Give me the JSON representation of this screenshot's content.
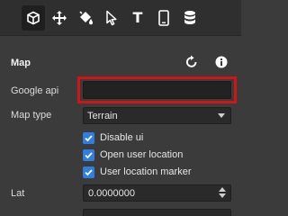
{
  "toolbar": {
    "tools": [
      {
        "icon": "cube-icon",
        "active": true
      },
      {
        "icon": "move-arrows-icon",
        "active": false
      },
      {
        "icon": "paint-bucket-icon",
        "active": false
      },
      {
        "icon": "cursor-pointer-icon",
        "active": false
      },
      {
        "icon": "text-tool-icon",
        "active": false,
        "glyph": "T"
      },
      {
        "icon": "phone-device-icon",
        "active": false
      },
      {
        "icon": "database-icon",
        "active": false
      }
    ]
  },
  "section": {
    "title": "Map",
    "reset_icon": "refresh-icon",
    "info_icon": "info-icon"
  },
  "fields": {
    "google_api": {
      "label": "Google api",
      "value": "",
      "placeholder": ""
    },
    "map_type": {
      "label": "Map type",
      "value": "Terrain"
    },
    "checkboxes": [
      {
        "label": "Disable ui",
        "checked": true
      },
      {
        "label": "Open user location",
        "checked": true
      },
      {
        "label": "User location marker",
        "checked": true
      }
    ],
    "lat": {
      "label": "Lat",
      "value": "0.0000000"
    }
  },
  "colors": {
    "background": "#3b3b3b",
    "toolbar": "#2f2f2f",
    "accent": "#2e7fe0",
    "highlight": "#d21414"
  }
}
